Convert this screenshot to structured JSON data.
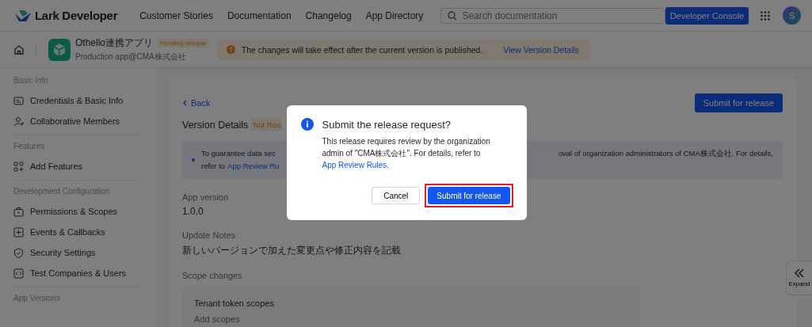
{
  "header": {
    "brand": "Lark Developer",
    "nav": [
      "Customer Stories",
      "Documentation",
      "Changelog",
      "App Directory"
    ],
    "search": {
      "placeholder": "Search documentation"
    },
    "console_button": "Developer Console",
    "avatar": "S"
  },
  "app_bar": {
    "app_name": "Othello連携アプリ",
    "status": "Pending release",
    "subtitle": "Production app@CMA株式会社",
    "banner": {
      "text": "The changes will take effect after the current version is published.",
      "link": "View Version Details"
    }
  },
  "sidebar": {
    "sections": [
      {
        "title": "Basic Info",
        "items": [
          "Credentials & Basic Info",
          "Collaborative Members"
        ]
      },
      {
        "title": "Features",
        "items": [
          "Add Features"
        ]
      },
      {
        "title": "Development Configuration",
        "items": [
          "Permissions & Scopes",
          "Events & Callbacks",
          "Security Settings",
          "Test Companies & Users"
        ]
      },
      {
        "title": "App Versions"
      }
    ]
  },
  "main": {
    "back": "Back",
    "submit_button": "Submit for release",
    "title": "Version Details",
    "status": "Not Req",
    "notice": {
      "line1_start": "To guarantee data sec",
      "line1_end": "oval of organization administrators of CMA株式会社. For details,",
      "line2_start": "refer to",
      "line2_link": "App Review Ru"
    },
    "fields": [
      {
        "label": "App version",
        "value": "1.0.0"
      },
      {
        "label": "Update Notes",
        "value": "新しいバージョンで加えた変更点や修正内容を記載"
      }
    ],
    "scope_changes": {
      "title": "Scope changes",
      "group_title": "Tenant token scopes",
      "add": "Add scopes"
    }
  },
  "expand": {
    "label": "Expand"
  },
  "modal": {
    "title": "Submit the release request?",
    "body": "This release requires review by the organization admin of \"CMA株式会社\". For details, refer to",
    "link": "App Review Rules",
    "body_end": ".",
    "cancel": "Cancel",
    "confirm": "Submit for release",
    "confirm_highlighted": true
  }
}
